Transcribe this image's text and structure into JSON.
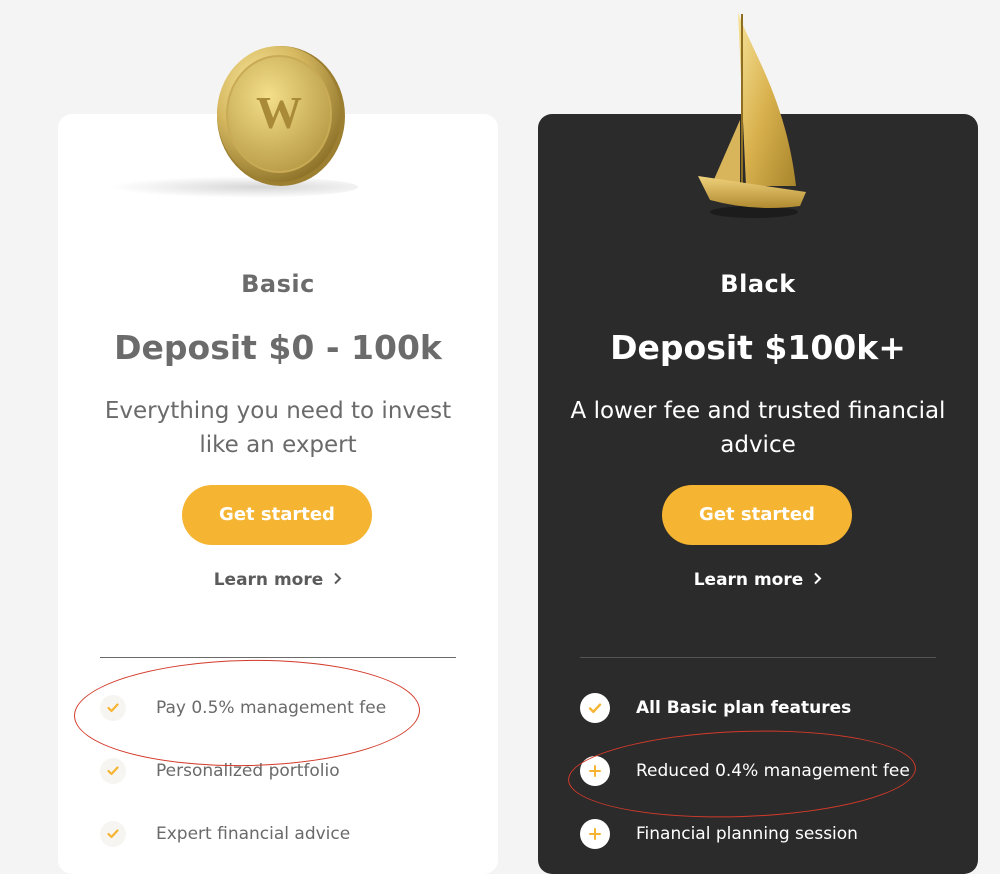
{
  "colors": {
    "page_bg": "#f4f4f4",
    "accent": "#f5b431",
    "black_card_bg": "#2b2b2b",
    "annotation": "#d23a2a"
  },
  "plans": {
    "basic": {
      "name": "Basic",
      "deposit": "Deposit $0 - 100k",
      "description": "Everything you need to invest like an expert",
      "cta_label": "Get started",
      "learn_more": "Learn more",
      "features": [
        {
          "icon": "check-icon",
          "text": "Pay 0.5% management fee",
          "bold": false
        },
        {
          "icon": "check-icon",
          "text": "Personalized portfolio",
          "bold": false
        },
        {
          "icon": "check-icon",
          "text": "Expert financial advice",
          "bold": false
        }
      ]
    },
    "black": {
      "name": "Black",
      "deposit": "Deposit $100k+",
      "description": "A lower fee and trusted financial advice",
      "cta_label": "Get started",
      "learn_more": "Learn more",
      "features": [
        {
          "icon": "check-icon",
          "text": "All Basic plan features",
          "bold": true
        },
        {
          "icon": "plus-icon",
          "text": "Reduced 0.4% management fee",
          "bold": false
        },
        {
          "icon": "plus-icon",
          "text": "Financial planning session",
          "bold": false
        }
      ]
    }
  },
  "coin": {
    "letter": "W"
  }
}
